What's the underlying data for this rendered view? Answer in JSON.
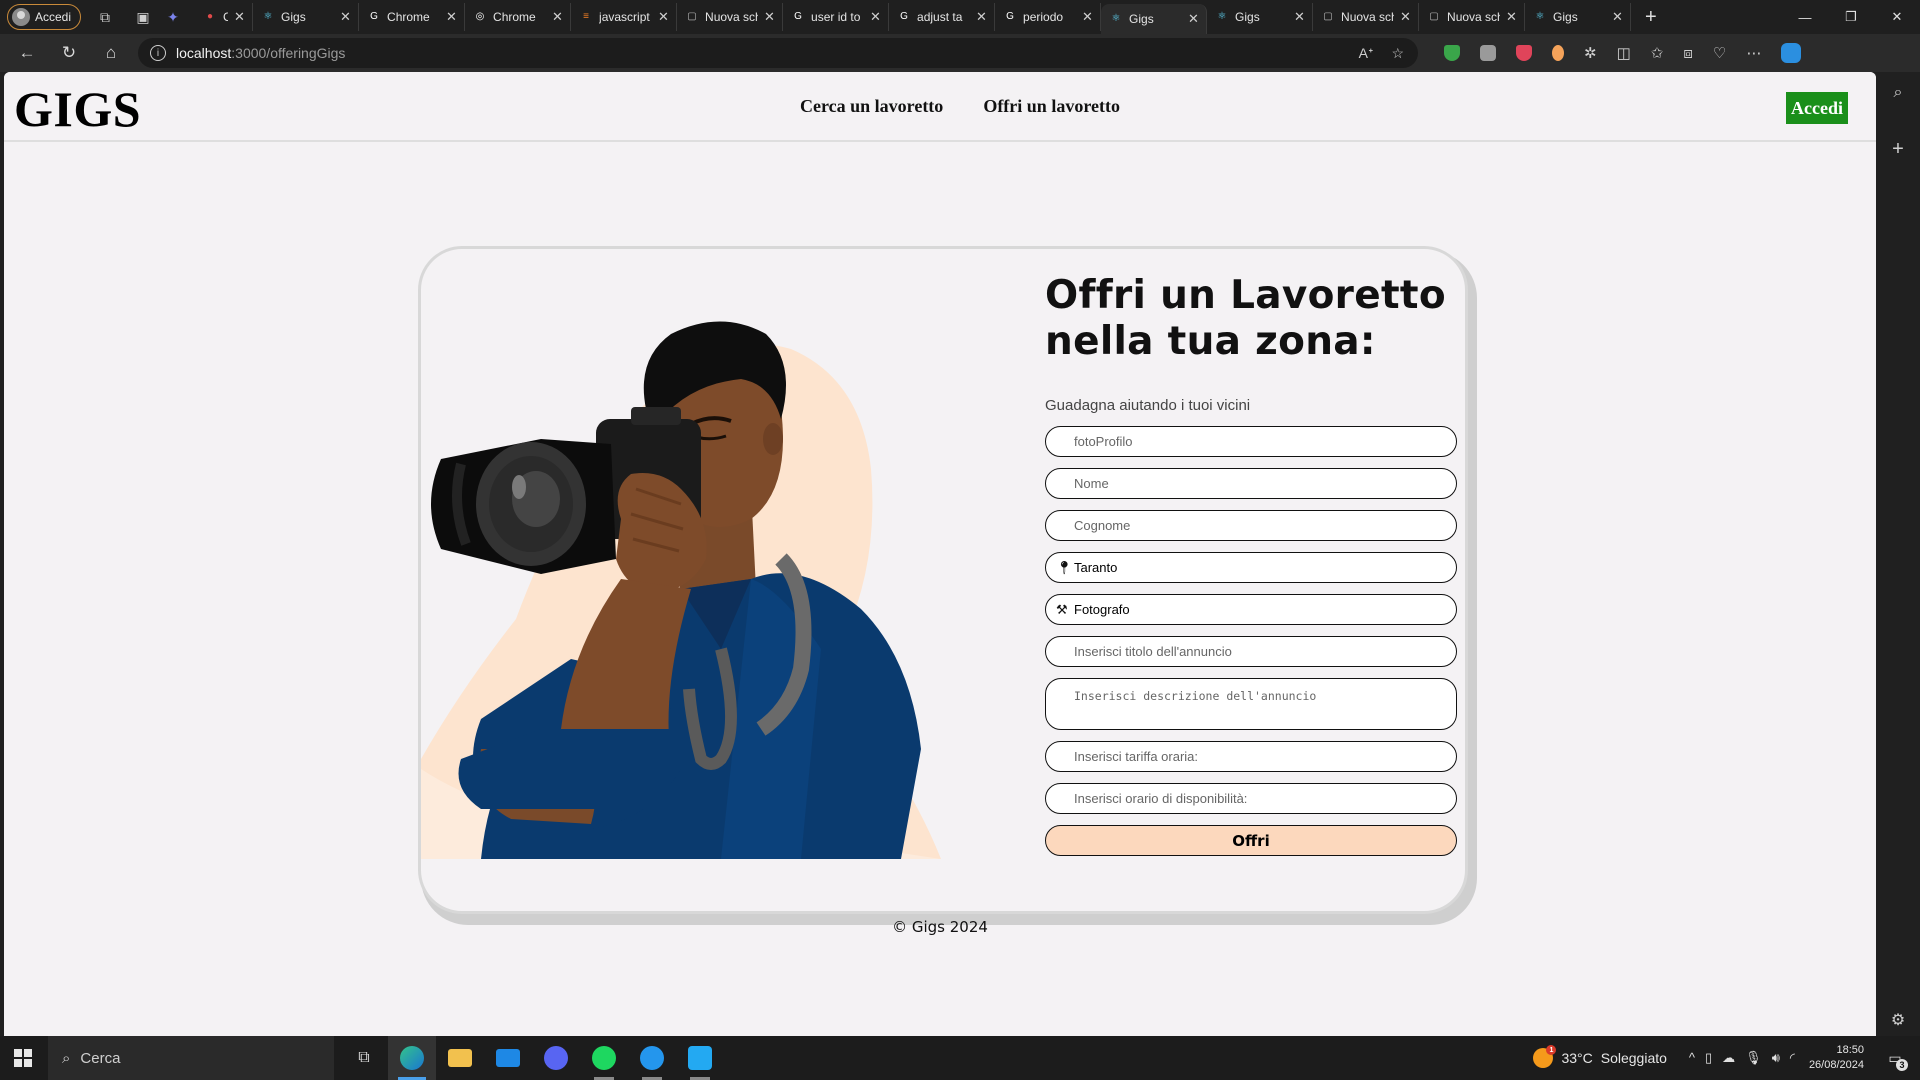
{
  "browser": {
    "profile_label": "Accedi",
    "tabs": [
      {
        "title": "Chat",
        "icon": "record-icon",
        "color": "#e04a4a",
        "narrow": true
      },
      {
        "title": "Gigs",
        "icon": "react-icon",
        "color": "#61dafb"
      },
      {
        "title": "Chrome",
        "icon": "google-icon",
        "color": "#ffffff"
      },
      {
        "title": "Chrome",
        "icon": "openai-icon",
        "color": "#ffffff"
      },
      {
        "title": "javascript",
        "icon": "stackoverflow-icon",
        "color": "#f48024"
      },
      {
        "title": "Nuova scheda",
        "icon": "newtab-icon",
        "color": "#bbbbbb"
      },
      {
        "title": "user id to",
        "icon": "google-icon",
        "color": "#ffffff"
      },
      {
        "title": "adjust ta",
        "icon": "google-icon",
        "color": "#ffffff"
      },
      {
        "title": "periodo",
        "icon": "google-icon",
        "color": "#ffffff"
      },
      {
        "title": "Gigs",
        "icon": "react-icon",
        "color": "#61dafb",
        "active": true
      },
      {
        "title": "Gigs",
        "icon": "react-icon",
        "color": "#61dafb"
      },
      {
        "title": "Nuova scheda",
        "icon": "newtab-icon",
        "color": "#bbbbbb"
      },
      {
        "title": "Nuova scheda",
        "icon": "newtab-icon",
        "color": "#bbbbbb"
      },
      {
        "title": "Gigs",
        "icon": "react-icon",
        "color": "#61dafb"
      }
    ],
    "url_host": "localhost",
    "url_path": ":3000/offeringGigs"
  },
  "site": {
    "logo": "GIGS",
    "nav": [
      "Cerca un lavoretto",
      "Offri un lavoretto"
    ],
    "login_label": "Accedi",
    "accent_green": "#1a8f1a"
  },
  "form": {
    "title_line1": "Offri un Lavoretto",
    "title_line2": "nella tua zona:",
    "subtitle": "Guadagna aiutando i tuoi vicini",
    "photo_placeholder": "fotoProfilo",
    "name_placeholder": "Nome",
    "surname_placeholder": "Cognome",
    "city_value": "Taranto",
    "category_value": "Fotografo",
    "title_placeholder": "Inserisci titolo dell'annuncio",
    "description_placeholder": "Inserisci descrizione dell'annuncio",
    "rate_placeholder": "Inserisci tariffa oraria:",
    "availability_placeholder": "Inserisci orario di disponibilità:",
    "submit_label": "Offri",
    "submit_color": "#fcd8bd"
  },
  "footer": "© Gigs 2024",
  "taskbar": {
    "search_placeholder": "Cerca",
    "weather_temp": "33°C",
    "weather_text": "Soleggiato",
    "weather_badge": "1",
    "time": "18:50",
    "date": "26/08/2024",
    "notification_count": "3"
  }
}
